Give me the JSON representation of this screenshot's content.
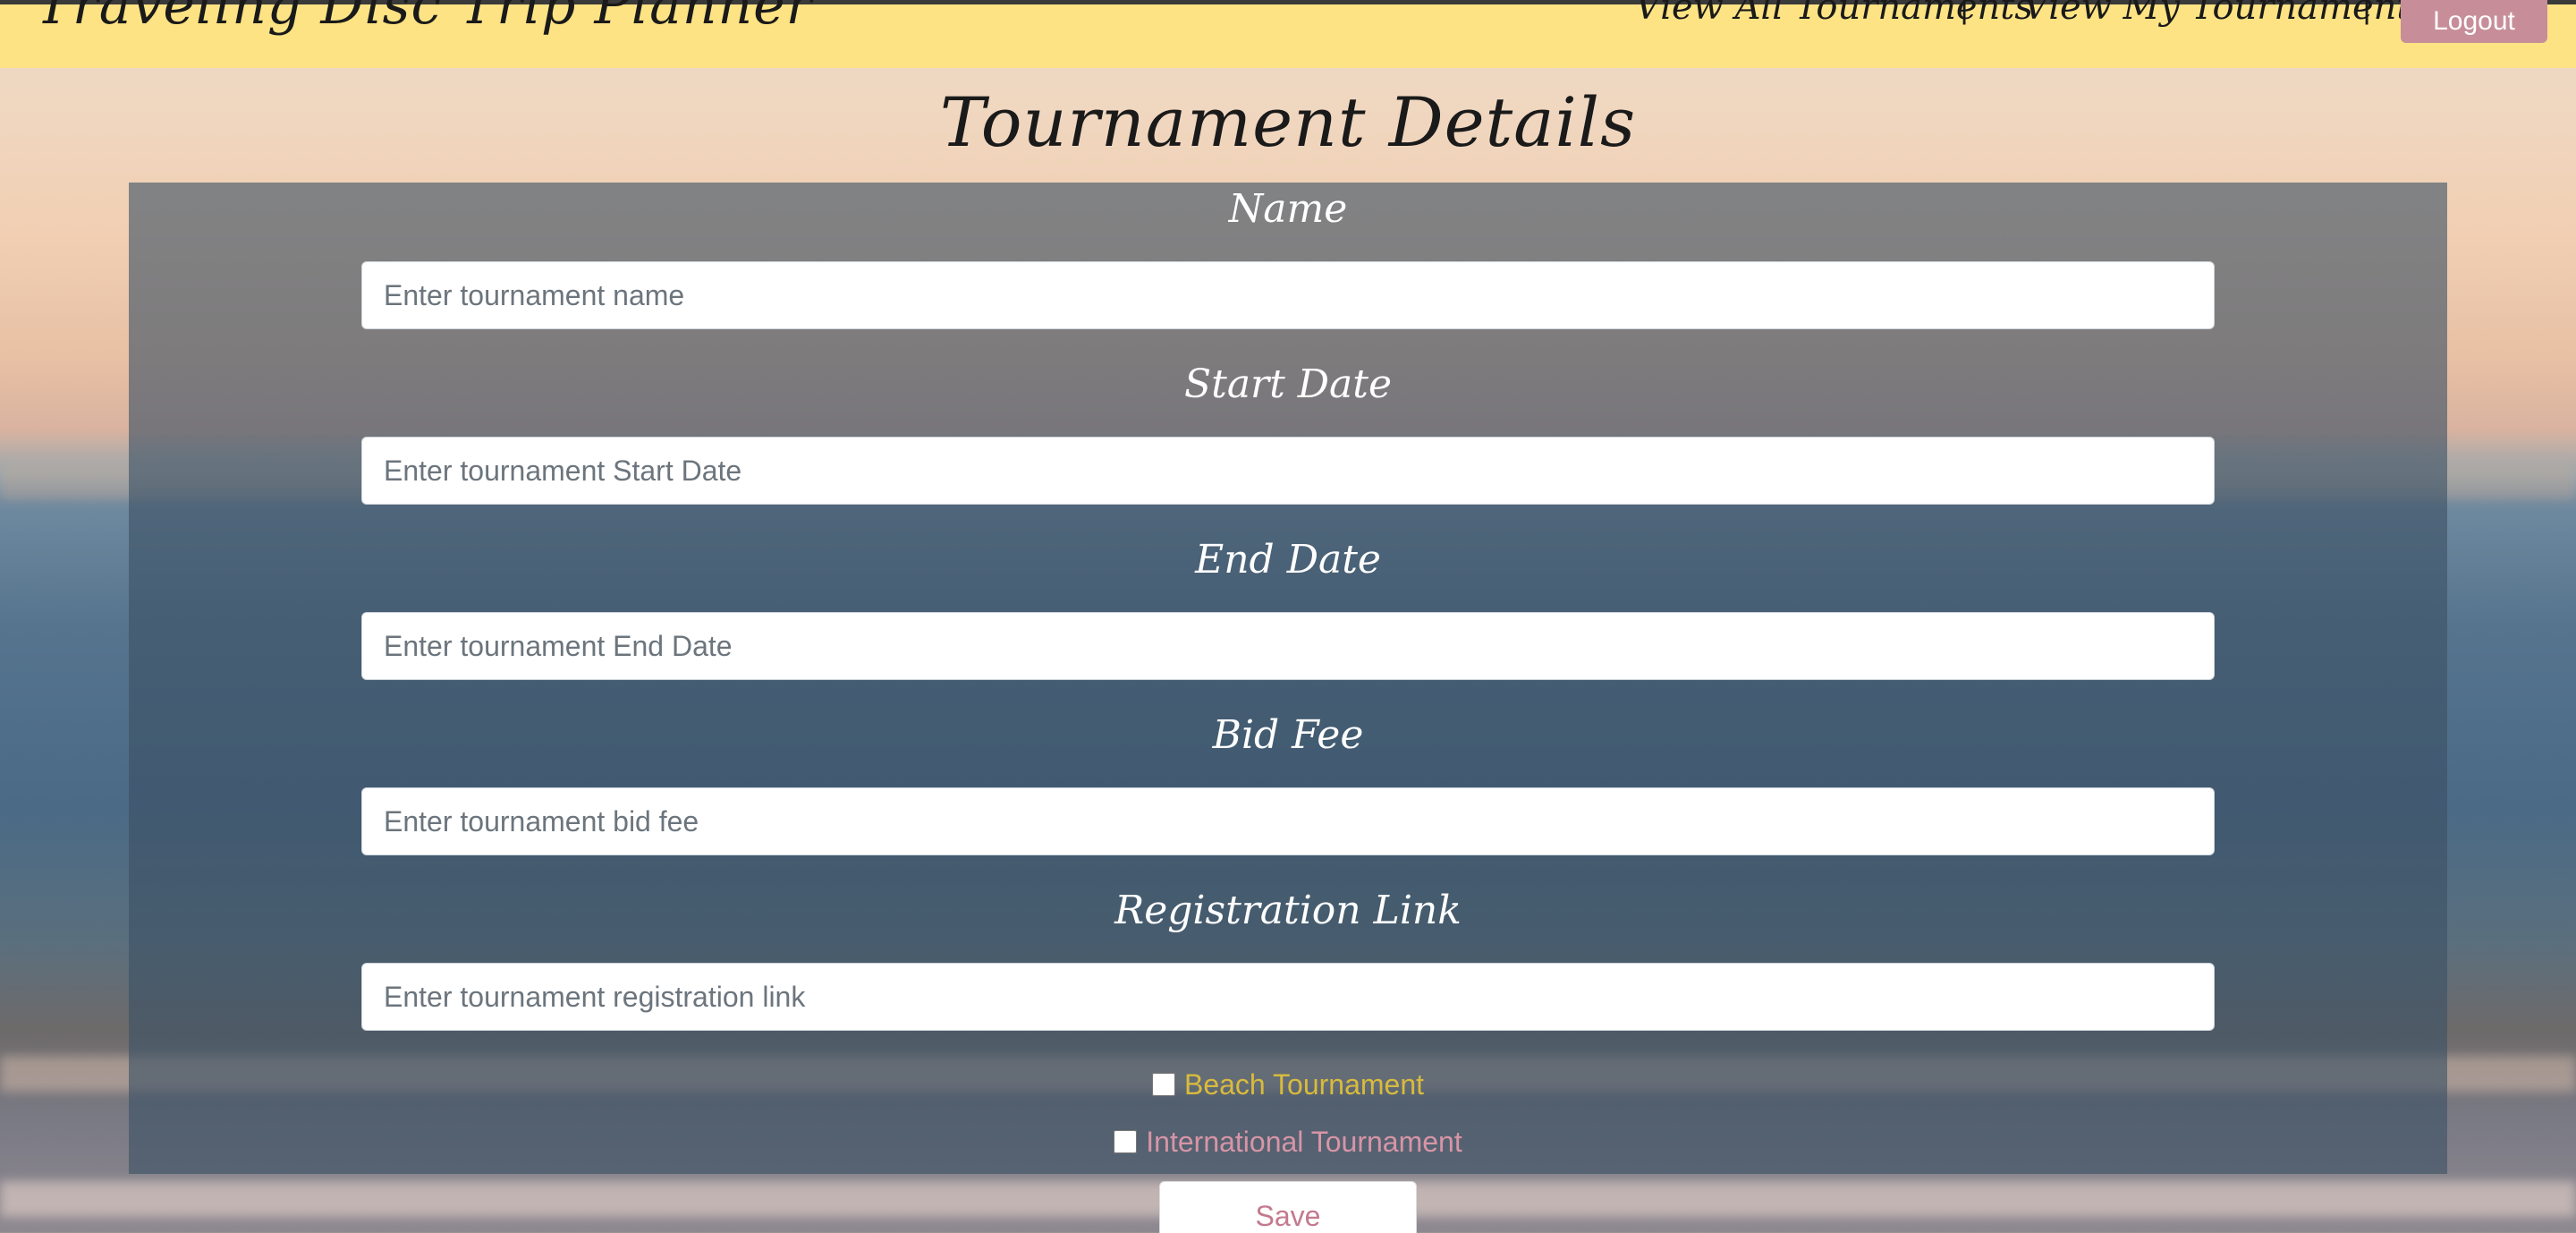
{
  "navbar": {
    "brand": "Traveling Disc Trip Planner",
    "links": [
      {
        "label": "View All Tournaments"
      },
      {
        "label": "View My Tournaments"
      }
    ],
    "separator": "|",
    "logout_label": "Logout"
  },
  "page": {
    "title": "Tournament Details"
  },
  "form": {
    "fields": [
      {
        "label": "Name",
        "placeholder": "Enter tournament name",
        "value": ""
      },
      {
        "label": "Start Date",
        "placeholder": "Enter tournament Start Date",
        "value": ""
      },
      {
        "label": "End Date",
        "placeholder": "Enter tournament End Date",
        "value": ""
      },
      {
        "label": "Bid Fee",
        "placeholder": "Enter tournament bid fee",
        "value": ""
      },
      {
        "label": "Registration Link",
        "placeholder": "Enter tournament registration link",
        "value": ""
      }
    ],
    "checkboxes": [
      {
        "label": "Beach Tournament",
        "checked": false,
        "color": "#d8bb3c"
      },
      {
        "label": "International Tournament",
        "checked": false,
        "color": "#d795a6"
      }
    ],
    "save_label": "Save",
    "save_color": "#c47a8e"
  },
  "colors": {
    "navbar_bg": "#fde383",
    "logout_bg": "#c78e9a"
  }
}
